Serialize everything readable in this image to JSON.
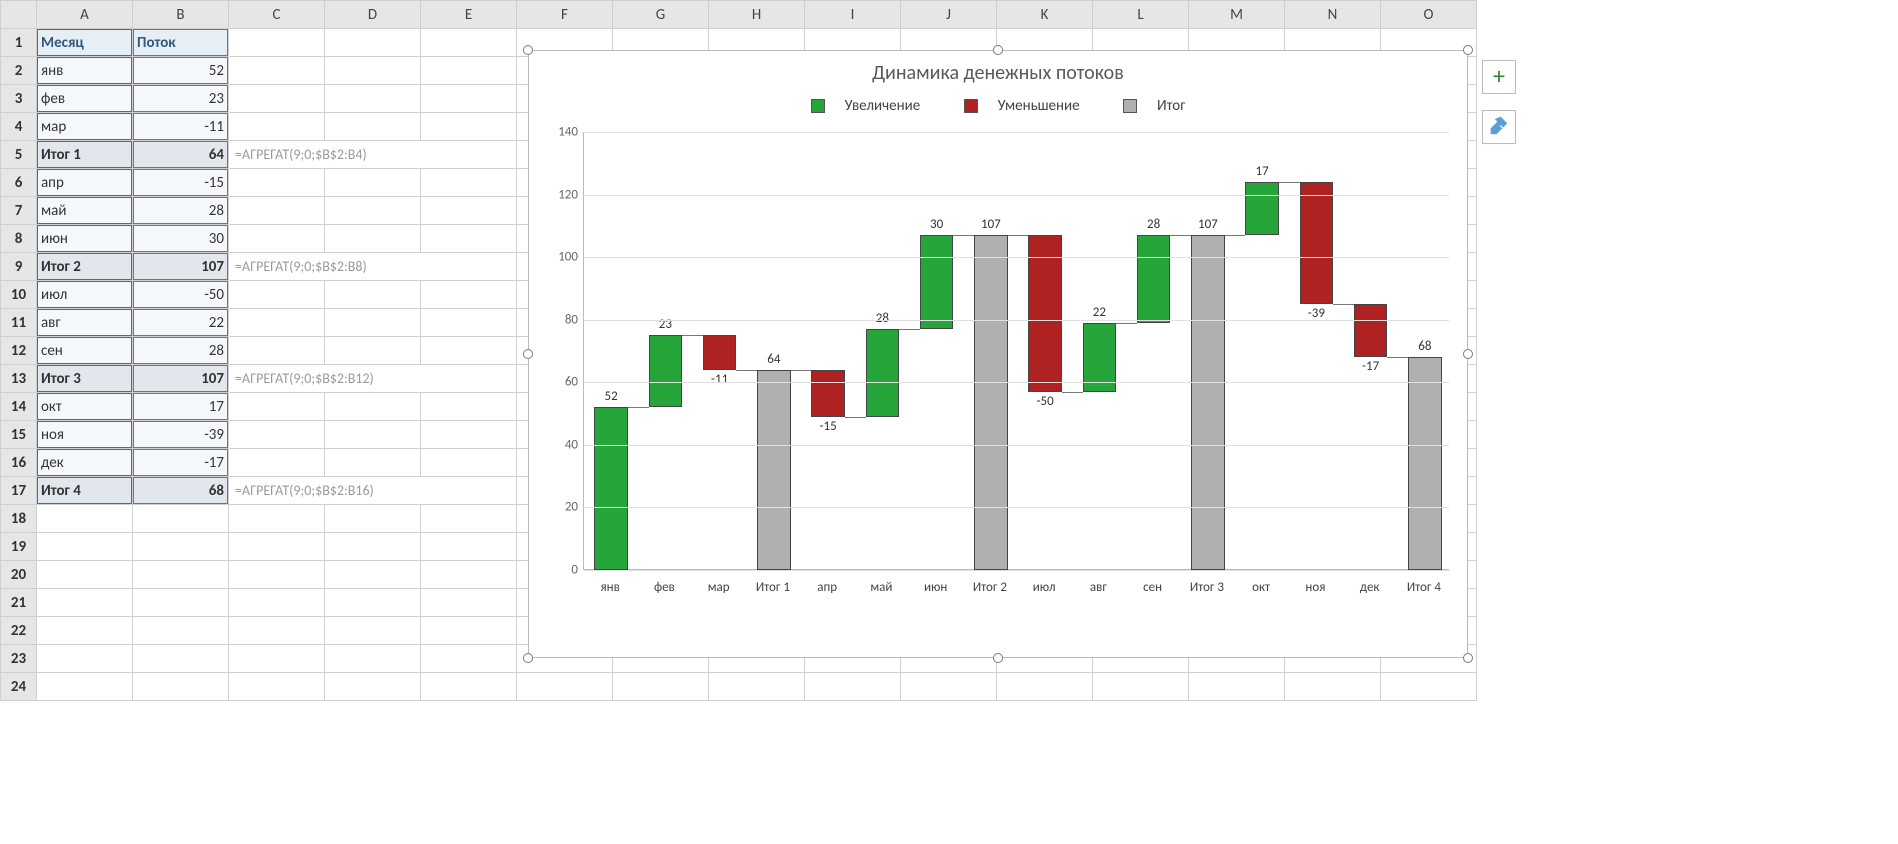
{
  "columns": [
    "A",
    "B",
    "C",
    "D",
    "E",
    "F",
    "G",
    "H",
    "I",
    "J",
    "K",
    "L",
    "M",
    "N",
    "O"
  ],
  "table": {
    "headers": {
      "A": "Месяц",
      "B": "Поток"
    },
    "rows": [
      {
        "r": 2,
        "a": "янв",
        "b": 52,
        "kind": "data"
      },
      {
        "r": 3,
        "a": "фев",
        "b": 23,
        "kind": "data"
      },
      {
        "r": 4,
        "a": "мар",
        "b": -11,
        "kind": "data"
      },
      {
        "r": 5,
        "a": "Итог 1",
        "b": 64,
        "kind": "subtotal",
        "formula": "=АГРЕГАТ(9;0;$B$2:B4)"
      },
      {
        "r": 6,
        "a": "апр",
        "b": -15,
        "kind": "data"
      },
      {
        "r": 7,
        "a": "май",
        "b": 28,
        "kind": "data"
      },
      {
        "r": 8,
        "a": "июн",
        "b": 30,
        "kind": "data"
      },
      {
        "r": 9,
        "a": "Итог 2",
        "b": 107,
        "kind": "subtotal",
        "formula": "=АГРЕГАТ(9;0;$B$2:B8)"
      },
      {
        "r": 10,
        "a": "июл",
        "b": -50,
        "kind": "data"
      },
      {
        "r": 11,
        "a": "авг",
        "b": 22,
        "kind": "data"
      },
      {
        "r": 12,
        "a": "сен",
        "b": 28,
        "kind": "data"
      },
      {
        "r": 13,
        "a": "Итог 3",
        "b": 107,
        "kind": "subtotal",
        "formula": "=АГРЕГАТ(9;0;$B$2:B12)"
      },
      {
        "r": 14,
        "a": "окт",
        "b": 17,
        "kind": "data"
      },
      {
        "r": 15,
        "a": "ноя",
        "b": -39,
        "kind": "data"
      },
      {
        "r": 16,
        "a": "дек",
        "b": -17,
        "kind": "data"
      },
      {
        "r": 17,
        "a": "Итог 4",
        "b": 68,
        "kind": "subtotal",
        "formula": "=АГРЕГАТ(9;0;$B$2:B16)"
      }
    ],
    "blank_rows": [
      18,
      19,
      20,
      21,
      22,
      23,
      24
    ]
  },
  "legend": {
    "inc": "Увеличение",
    "dec": "Уменьшение",
    "tot": "Итог"
  },
  "chart_data": {
    "type": "bar",
    "subtype": "waterfall",
    "title": "Динамика денежных потоков",
    "ylim": [
      0,
      140
    ],
    "ystep": 20,
    "categories": [
      "янв",
      "фев",
      "мар",
      "Итог 1",
      "апр",
      "май",
      "июн",
      "Итог 2",
      "июл",
      "авг",
      "сен",
      "Итог 3",
      "окт",
      "ноя",
      "дек",
      "Итог 4"
    ],
    "items": [
      {
        "cat": "янв",
        "value": 52,
        "type": "inc",
        "bottom": 0,
        "top": 52,
        "label": "52"
      },
      {
        "cat": "фев",
        "value": 23,
        "type": "inc",
        "bottom": 52,
        "top": 75,
        "label": "23"
      },
      {
        "cat": "мар",
        "value": -11,
        "type": "dec",
        "bottom": 64,
        "top": 75,
        "label": "-11"
      },
      {
        "cat": "Итог 1",
        "value": 64,
        "type": "total",
        "bottom": 0,
        "top": 64,
        "label": "64"
      },
      {
        "cat": "апр",
        "value": -15,
        "type": "dec",
        "bottom": 49,
        "top": 64,
        "label": "-15"
      },
      {
        "cat": "май",
        "value": 28,
        "type": "inc",
        "bottom": 49,
        "top": 77,
        "label": "28"
      },
      {
        "cat": "июн",
        "value": 30,
        "type": "inc",
        "bottom": 77,
        "top": 107,
        "label": "30"
      },
      {
        "cat": "Итог 2",
        "value": 107,
        "type": "total",
        "bottom": 0,
        "top": 107,
        "label": "107"
      },
      {
        "cat": "июл",
        "value": -50,
        "type": "dec",
        "bottom": 57,
        "top": 107,
        "label": "-50"
      },
      {
        "cat": "авг",
        "value": 22,
        "type": "inc",
        "bottom": 57,
        "top": 79,
        "label": "22"
      },
      {
        "cat": "сен",
        "value": 28,
        "type": "inc",
        "bottom": 79,
        "top": 107,
        "label": "28"
      },
      {
        "cat": "Итог 3",
        "value": 107,
        "type": "total",
        "bottom": 0,
        "top": 107,
        "label": "107"
      },
      {
        "cat": "окт",
        "value": 17,
        "type": "inc",
        "bottom": 107,
        "top": 124,
        "label": "17"
      },
      {
        "cat": "ноя",
        "value": -39,
        "type": "dec",
        "bottom": 85,
        "top": 124,
        "label": "-39"
      },
      {
        "cat": "дек",
        "value": -17,
        "type": "dec",
        "bottom": 68,
        "top": 85,
        "label": "-17"
      },
      {
        "cat": "Итог 4",
        "value": 68,
        "type": "total",
        "bottom": 0,
        "top": 68,
        "label": "68"
      }
    ]
  }
}
